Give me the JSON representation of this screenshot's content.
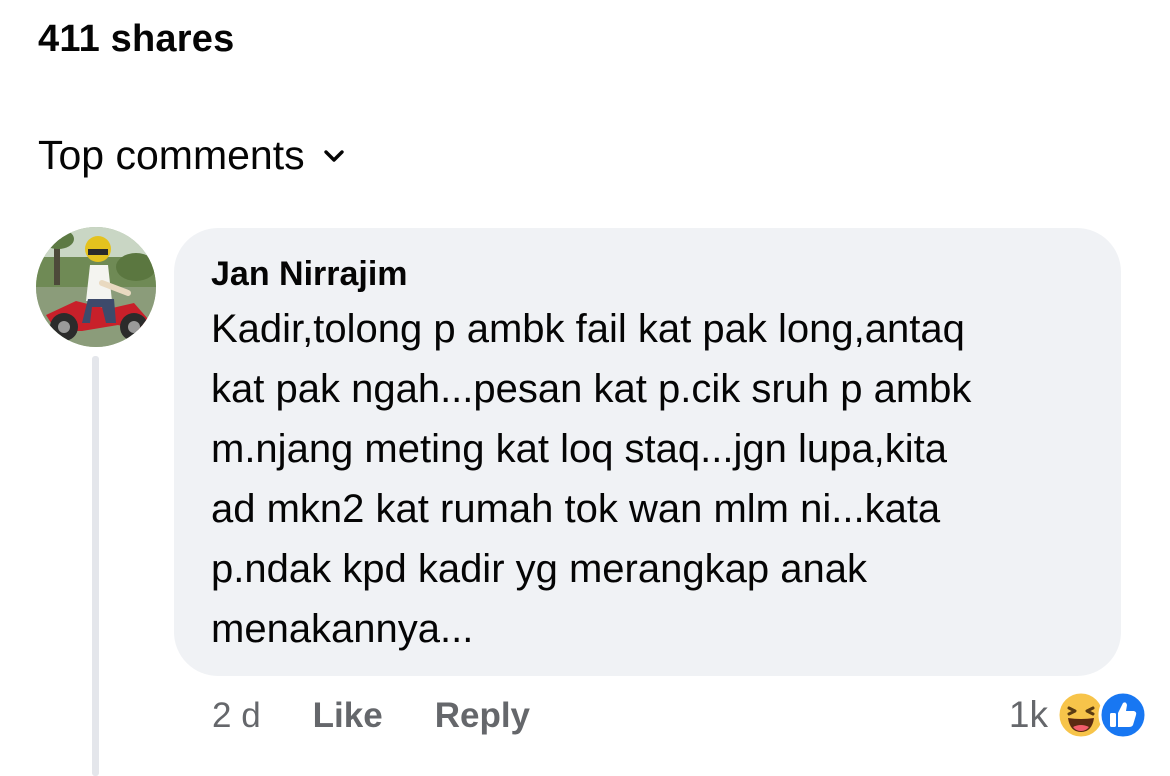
{
  "post": {
    "shares_label": "411 shares"
  },
  "comments_section": {
    "sort_label": "Top comments"
  },
  "comment": {
    "author": "Jan Nirrajim",
    "text": "Kadir,tolong p ambk fail kat pak long,antaq\nkat pak ngah...pesan kat p.cik sruh p ambk\nm.njang meting kat loq staq...jgn lupa,kita\nad mkn2 kat rumah tok wan mlm ni...kata\np.ndak kpd kadir yg merangkap anak\nmenakannya...",
    "timestamp": "2 d",
    "like_label": "Like",
    "reply_label": "Reply",
    "reaction_count": "1k",
    "reaction_icons": [
      "haha-icon",
      "like-icon"
    ]
  },
  "colors": {
    "bubble_bg": "#f0f2f5",
    "meta_text": "#65676b",
    "like_blue": "#1877f2",
    "haha_yellow": "#f7c44a"
  }
}
